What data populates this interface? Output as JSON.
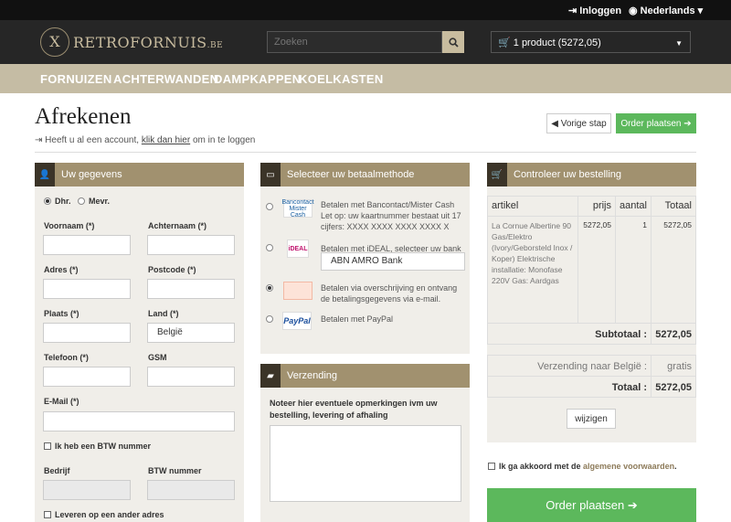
{
  "topbar": {
    "login": "Inloggen",
    "language": "Nederlands"
  },
  "logo": {
    "emblem": "X",
    "name": "RETROFORNUIS",
    "tld": ".BE"
  },
  "search": {
    "placeholder": "Zoeken"
  },
  "cart": {
    "summary": "1 product (5272,05)"
  },
  "nav": [
    "FORNUIZEN",
    "ACHTERWANDEN",
    "DAMPKAPPEN",
    "KOELKASTEN"
  ],
  "page": {
    "title": "Afrekenen",
    "account_prefix": "Heeft u al een account,",
    "account_link": "klik dan hier",
    "account_suffix": "om in te loggen",
    "prev_label": "Vorige stap",
    "order_label": "Order plaatsen"
  },
  "details": {
    "title": "Uw gegevens",
    "salutation": [
      "Dhr.",
      "Mevr."
    ],
    "first_name": "Voornaam (*)",
    "last_name": "Achternaam (*)",
    "address": "Adres (*)",
    "postcode": "Postcode (*)",
    "city": "Plaats (*)",
    "country": "Land (*)",
    "country_value": "België",
    "phone": "Telefoon (*)",
    "gsm": "GSM",
    "email": "E-Mail (*)",
    "vat_check": "Ik heb een BTW nummer",
    "company": "Bedrijf",
    "vat_number": "BTW nummer",
    "other_address": "Leveren op een ander adres"
  },
  "payment": {
    "title": "Selecteer uw betaalmethode",
    "methods": [
      {
        "logo": "Bancontact Mister Cash",
        "text": "Betalen met Bancontact/Mister Cash Let op: uw kaartnummer bestaat uit 17 cijfers: XXXX XXXX XXXX XXXX X"
      },
      {
        "logo": "iDEAL",
        "text": "Betalen met iDEAL, selecteer uw bank"
      },
      {
        "logo": "",
        "text": "Betalen via overschrijving en ontvang de betalingsgegevens via e-mail."
      },
      {
        "logo": "PayPal",
        "text": "Betalen met PayPal"
      }
    ],
    "bank": "ABN AMRO Bank"
  },
  "shipping": {
    "title": "Verzending",
    "note_label": "Noteer hier eventuele opmerkingen ivm uw bestelling, levering of afhaling"
  },
  "order": {
    "title": "Controleer uw bestelling",
    "headers": [
      "artikel",
      "prijs",
      "aantal",
      "Totaal"
    ],
    "item": {
      "name": "La Cornue Albertine 90 Gas/Elektro (Ivory/Geborsteld Inox / Koper) Elektrische installatie: Monofase 220V Gas: Aardgas",
      "price": "5272,05",
      "qty": "1",
      "total": "5272,05"
    },
    "subtotal_label": "Subtotaal :",
    "subtotal": "5272,05",
    "shipping_label": "Verzending naar België :",
    "shipping": "gratis",
    "total_label": "Totaal :",
    "total": "5272,05",
    "edit": "wijzigen",
    "agree_prefix": "Ik ga akkoord met de",
    "agree_link": "algemene voorwaarden",
    "agree_suffix": ".",
    "place": "Order plaatsen"
  },
  "colors": {
    "accent": "#a1916f",
    "nav": "#c5bca4",
    "green": "#5cb85c",
    "dark": "#262626"
  }
}
